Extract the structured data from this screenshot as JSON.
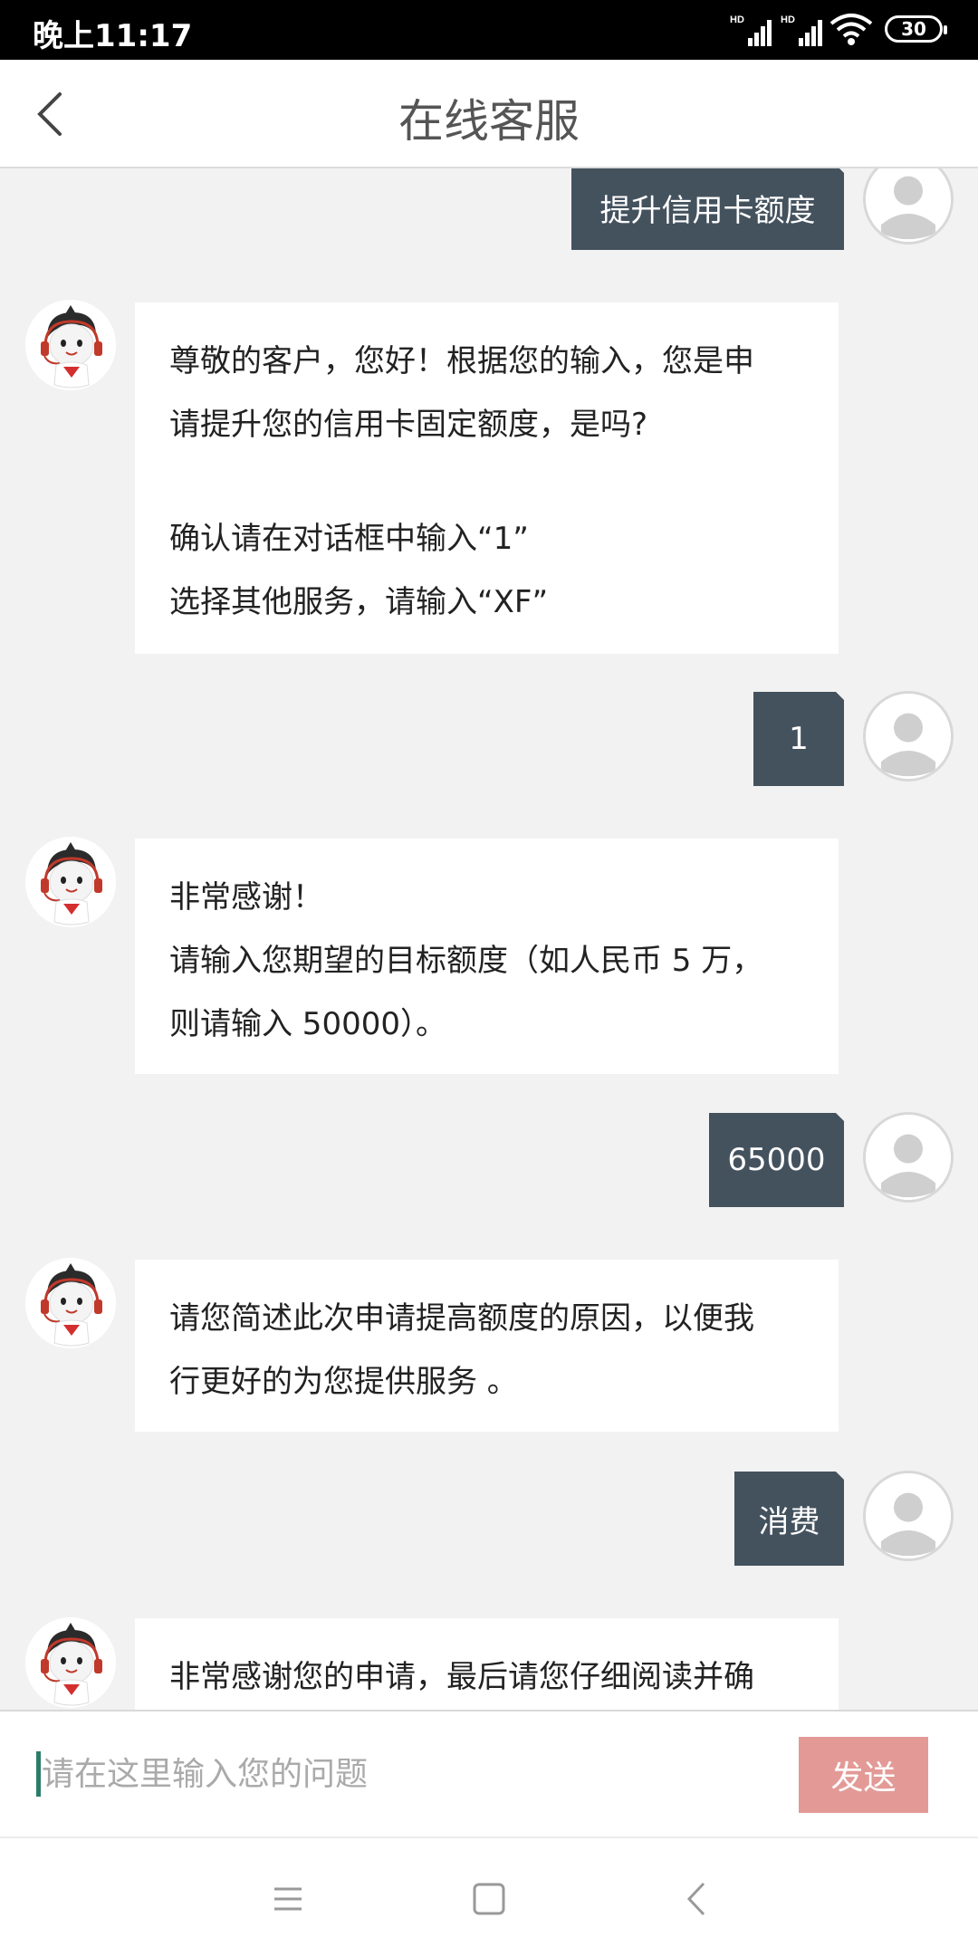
{
  "status_bar": {
    "time": "晚上11:17",
    "battery": "30",
    "icons": [
      "hd-signal-icon",
      "hd-signal-icon",
      "wifi-icon",
      "battery-icon"
    ]
  },
  "header": {
    "title": "在线客服",
    "back_icon": "chevron-left-icon"
  },
  "messages": [
    {
      "from": "user",
      "text": "提升信用卡额度"
    },
    {
      "from": "bot",
      "lines": [
        "尊敬的客户，您好！根据您的输入，您是申",
        "请提升您的信用卡固定额度，是吗?",
        "",
        "确认请在对话框中输入“1”",
        "选择其他服务，请输入“XF”"
      ]
    },
    {
      "from": "user",
      "text": "1"
    },
    {
      "from": "bot",
      "lines": [
        "非常感谢！",
        "请输入您期望的目标额度（如人民币 5 万，",
        "则请输入 50000）。"
      ]
    },
    {
      "from": "user",
      "text": "65000"
    },
    {
      "from": "bot",
      "lines": [
        "请您简述此次申请提高额度的原因，以便我",
        "行更好的为您提供服务 。"
      ]
    },
    {
      "from": "user",
      "text": "消费"
    },
    {
      "from": "bot",
      "lines": [
        "非常感谢您的申请，最后请您仔细阅读并确"
      ]
    }
  ],
  "input": {
    "placeholder": "请在这里输入您的问题",
    "value": "",
    "send_label": "发送"
  },
  "colors": {
    "user_bubble": "#44525e",
    "send_button": "#e39a96",
    "background": "#f2f2f2"
  },
  "nav": [
    "menu-icon",
    "home-square-icon",
    "back-chevron-icon"
  ]
}
